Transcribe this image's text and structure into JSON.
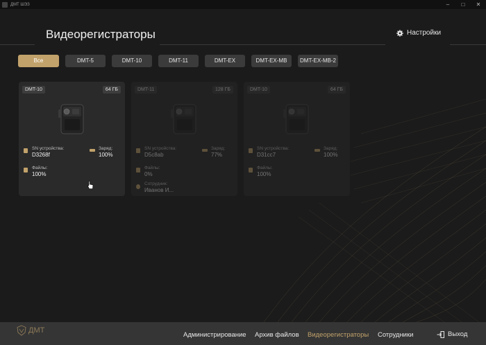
{
  "window": {
    "title": "ДМТ ШЭЗ"
  },
  "header": {
    "title": "Видеорегистраторы",
    "settings_label": "Настройки"
  },
  "filters": [
    {
      "label": "Все",
      "active": true
    },
    {
      "label": "DMT-5"
    },
    {
      "label": "DMT-10"
    },
    {
      "label": "DMT-11"
    },
    {
      "label": "DMT-EX"
    },
    {
      "label": "DMT-EX-MB"
    },
    {
      "label": "DMT-EX-MB-2"
    }
  ],
  "cards": [
    {
      "model": "DMT-10",
      "storage": "64 ГБ",
      "sn_label": "SN устройства:",
      "sn": "D3268f",
      "charge_label": "Заряд:",
      "charge": "100%",
      "files_label": "Файлы:",
      "files": "100%"
    },
    {
      "model": "DMT-11",
      "storage": "128 ГБ",
      "sn_label": "SN устройства:",
      "sn": "D5c8ab",
      "charge_label": "Заряд:",
      "charge": "77%",
      "files_label": "Файлы:",
      "files": "0%",
      "employee_label": "Сотрудник:",
      "employee": "Иванов И..."
    },
    {
      "model": "DMT-10",
      "storage": "64 ГБ",
      "sn_label": "SN устройства:",
      "sn": "D31cc7",
      "charge_label": "Заряд:",
      "charge": "100%",
      "files_label": "Файлы:",
      "files": "100%"
    }
  ],
  "footer": {
    "logo_text": "ДМТ",
    "nav": [
      {
        "label": "Администрирование"
      },
      {
        "label": "Архив файлов"
      },
      {
        "label": "Видеорегистраторы",
        "active": true
      },
      {
        "label": "Сотрудники"
      }
    ],
    "exit_label": "Выход"
  },
  "colors": {
    "accent": "#c2a26b",
    "background": "#1b1b1b",
    "card": "#2a2a2a",
    "bar": "#353535"
  }
}
